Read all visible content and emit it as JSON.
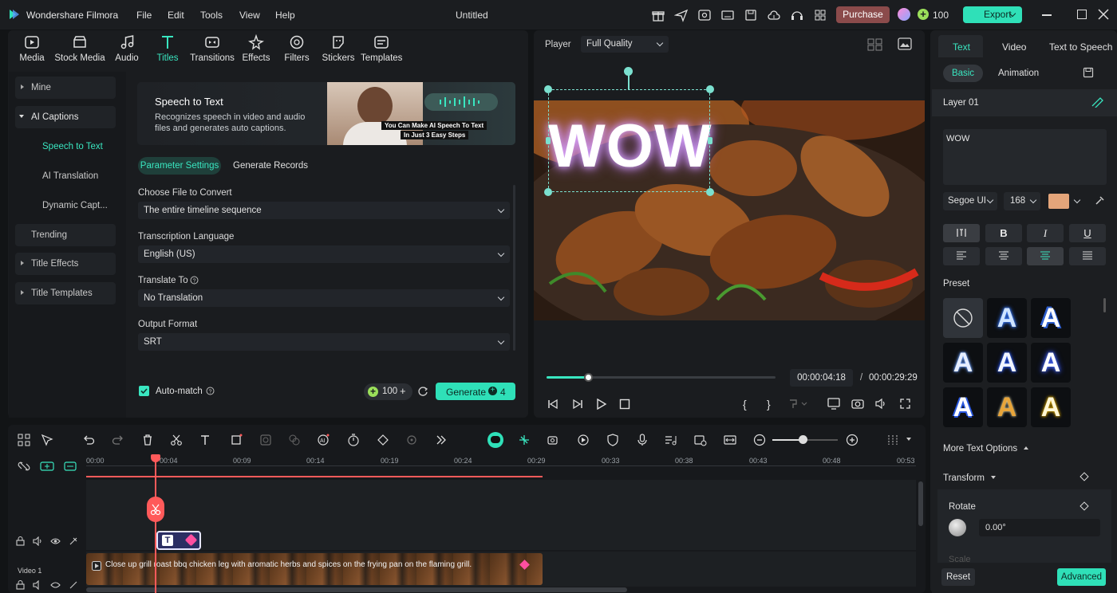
{
  "titlebar": {
    "app_name": "Wondershare Filmora",
    "menus": [
      "File",
      "Edit",
      "Tools",
      "View",
      "Help"
    ],
    "doc_title": "Untitled",
    "purchase_label": "Purchase",
    "credits": "100",
    "export_label": "Export"
  },
  "media_nav": {
    "items": [
      {
        "label": "Media",
        "icon": "media-icon"
      },
      {
        "label": "Stock Media",
        "icon": "stock-media-icon"
      },
      {
        "label": "Audio",
        "icon": "audio-icon"
      },
      {
        "label": "Titles",
        "icon": "titles-icon"
      },
      {
        "label": "Transitions",
        "icon": "transitions-icon"
      },
      {
        "label": "Effects",
        "icon": "effects-icon"
      },
      {
        "label": "Filters",
        "icon": "filters-icon"
      },
      {
        "label": "Stickers",
        "icon": "stickers-icon"
      },
      {
        "label": "Templates",
        "icon": "templates-icon"
      }
    ],
    "active": "Titles"
  },
  "sidebar": {
    "items": [
      {
        "label": "Mine"
      },
      {
        "label": "AI Captions"
      },
      {
        "label": "Speech to Text"
      },
      {
        "label": "AI Translation"
      },
      {
        "label": "Dynamic Capt..."
      },
      {
        "label": "Trending"
      },
      {
        "label": "Title Effects"
      },
      {
        "label": "Title Templates"
      }
    ]
  },
  "speech_to_text": {
    "banner_title": "Speech to Text",
    "banner_desc": "Recognizes speech in video and audio files and generates auto captions.",
    "banner_overlay_1": "You Can Make AI Speech To Text",
    "banner_overlay_2": "In Just  3 Easy Steps",
    "tab_params": "Parameter Settings",
    "tab_records": "Generate Records",
    "file_label": "Choose File to Convert",
    "file_value": "The entire timeline sequence",
    "lang_label": "Transcription Language",
    "lang_value": "English (US)",
    "translate_label": "Translate To",
    "translate_value": "No Translation",
    "format_label": "Output Format",
    "format_value": "SRT",
    "automatch_label": "Auto-match",
    "credits": "100",
    "generate_label": "Generate",
    "generate_cost": "4"
  },
  "player": {
    "label": "Player",
    "quality": "Full Quality",
    "overlay_text": "WOW",
    "current_time": "00:00:04:18",
    "separator": "/",
    "total_time": "00:00:29:29",
    "progress": 0.18
  },
  "right_panel": {
    "tabs": [
      "Text",
      "Video",
      "Text to Speech"
    ],
    "subtabs": [
      "Basic",
      "Animation"
    ],
    "layer": "Layer 01",
    "text_value": "WOW",
    "font": "Segoe UI",
    "size": "168",
    "color": "#e4a57a",
    "bold": "B",
    "italic": "I",
    "underline": "U",
    "preset_label": "Preset",
    "more_options": "More Text Options",
    "transform_label": "Transform",
    "rotate_label": "Rotate",
    "rotate_value": "0.00°",
    "scale_label": "Scale",
    "reset_label": "Reset",
    "advanced_label": "Advanced"
  },
  "timeline": {
    "ruler": [
      "00:00",
      "00:04",
      "00:09",
      "00:14",
      "00:19",
      "00:24",
      "00:29",
      "00:33",
      "00:38",
      "00:43",
      "00:48",
      "00:53"
    ],
    "track_label": "Video 1",
    "clip_text": "Close up grill roast bbq chicken leg with aromatic herbs and spices on the frying pan on the flaming grill.",
    "title_clip_letter": "T"
  },
  "colors": {
    "accent": "#2fe0b8",
    "purchase": "#8b4b4b",
    "playhead": "#ff5a5a"
  }
}
